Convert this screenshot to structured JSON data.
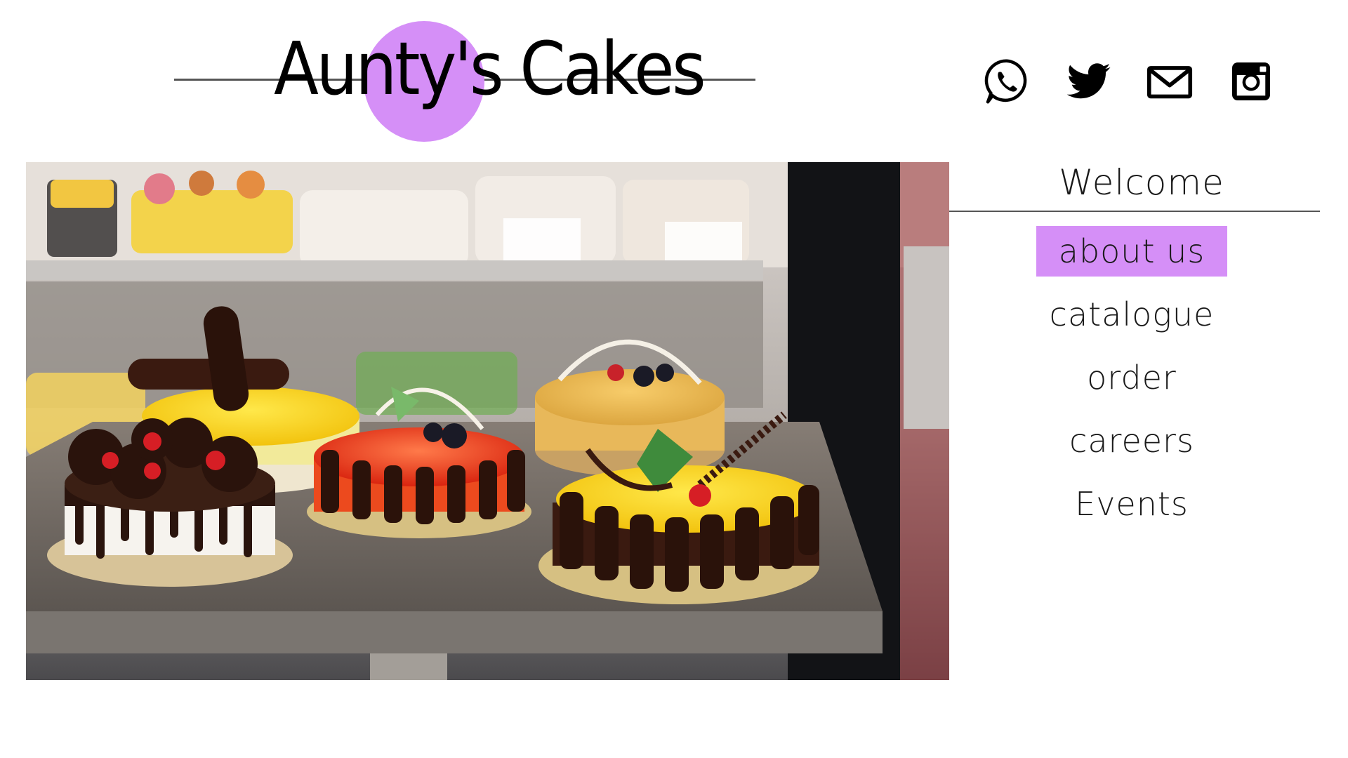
{
  "brand": {
    "name": "Aunty's Cakes",
    "accent_color": "#d58ff7"
  },
  "social": [
    {
      "name": "whatsapp-icon",
      "label": "WhatsApp"
    },
    {
      "name": "twitter-icon",
      "label": "Twitter"
    },
    {
      "name": "mail-icon",
      "label": "Email"
    },
    {
      "name": "instagram-icon",
      "label": "Instagram"
    }
  ],
  "hero": {
    "alt": "Cakes on display table in a bakery"
  },
  "nav": {
    "title": "Welcome",
    "items": [
      {
        "label": "about us",
        "active": true
      },
      {
        "label": "catalogue",
        "active": false
      },
      {
        "label": "order",
        "active": false
      },
      {
        "label": "careers",
        "active": false
      },
      {
        "label": "Events",
        "active": false
      }
    ]
  }
}
